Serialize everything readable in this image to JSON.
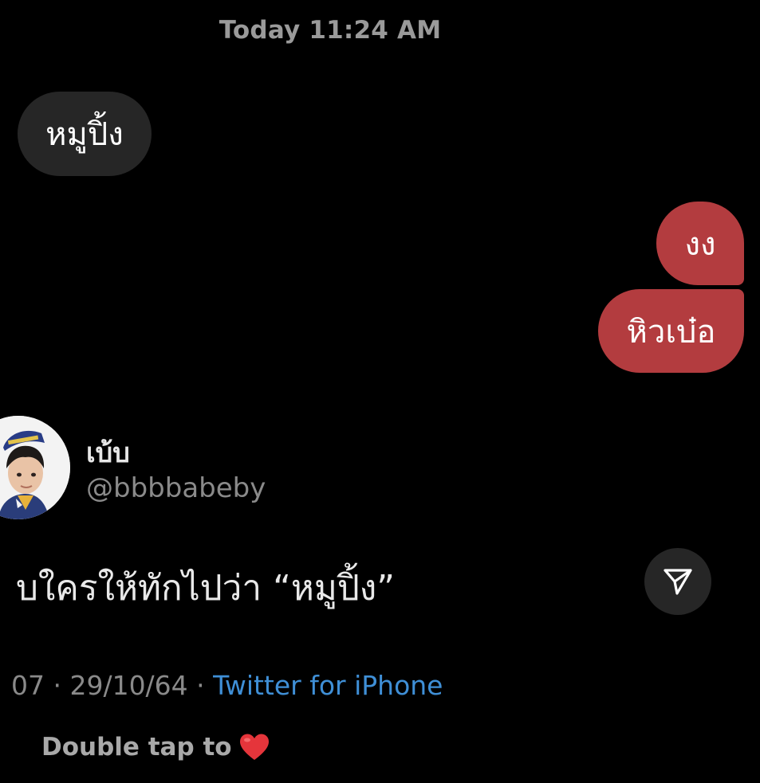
{
  "header": {
    "timestamp": "Today 11:24 AM"
  },
  "messages": [
    {
      "direction": "received",
      "text": "หมูปิ้ง"
    },
    {
      "direction": "sent",
      "text": "งง"
    },
    {
      "direction": "sent",
      "text": "หิวเบ๋อ"
    }
  ],
  "shared_post": {
    "author_name": "เบ้บ",
    "author_handle": "@bbbbabeby",
    "text": "บใครให้ทักไปว่า “หมูปิ้ง”",
    "meta_prefix": "07 · 29/10/64 · ",
    "meta_source": "Twitter for iPhone",
    "share_icon": "send-icon"
  },
  "footer": {
    "double_tap_text": "Double tap to",
    "reaction_icon": "heart-icon"
  },
  "colors": {
    "background": "#000000",
    "sent_bubble": "#b33c3f",
    "received_bubble": "#262626",
    "link": "#3f8fd6"
  }
}
